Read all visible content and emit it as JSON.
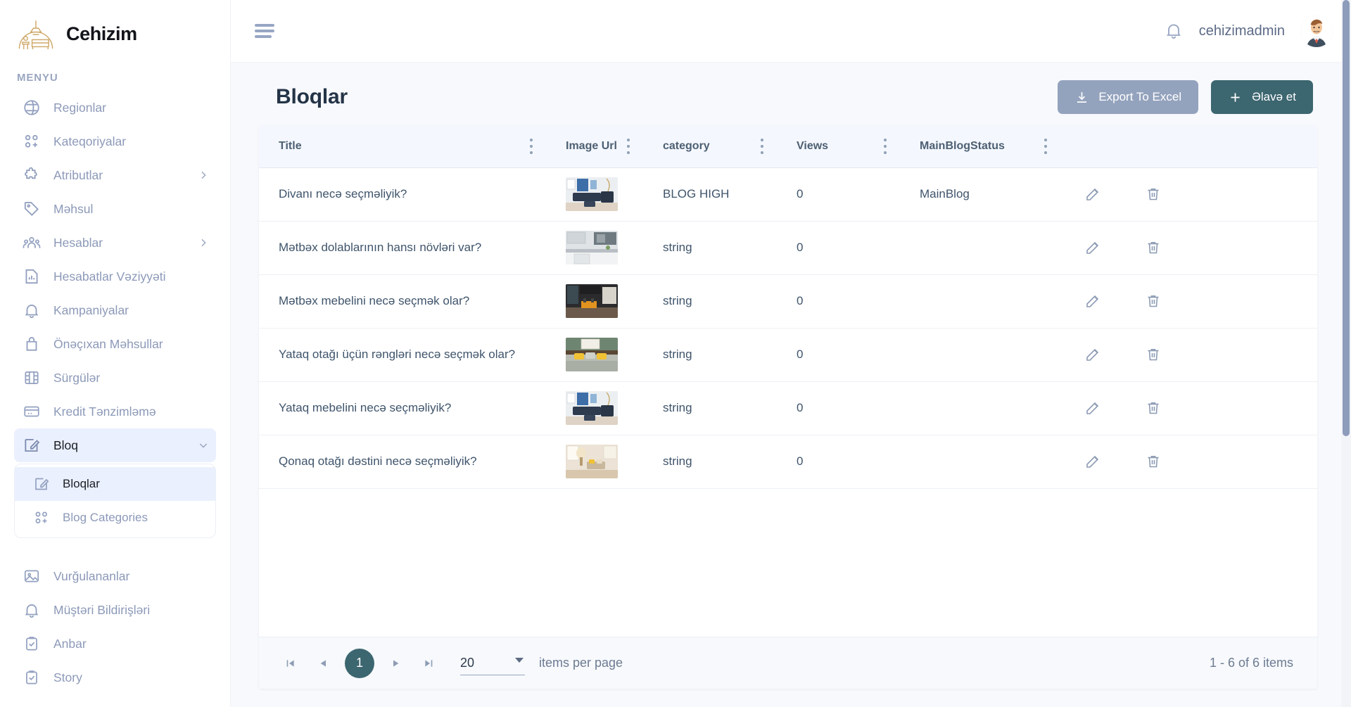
{
  "brand": {
    "name": "Cehizim",
    "logo_icon": "furniture-arch-logo"
  },
  "sidebar": {
    "section_label": "MENYU",
    "items": [
      {
        "label": "Regionlar",
        "icon": "globe-icon",
        "expandable": false
      },
      {
        "label": "Kateqoriyalar",
        "icon": "categories-icon",
        "expandable": false
      },
      {
        "label": "Atributlar",
        "icon": "puzzle-icon",
        "expandable": true
      },
      {
        "label": "Məhsul",
        "icon": "tag-icon",
        "expandable": false
      },
      {
        "label": "Hesablar",
        "icon": "users-icon",
        "expandable": true
      },
      {
        "label": "Hesabatlar Vəziyyəti",
        "icon": "report-icon",
        "expandable": false
      },
      {
        "label": "Kampaniyalar",
        "icon": "bell-icon",
        "expandable": false
      },
      {
        "label": "Önəçıxan Məhsullar",
        "icon": "bag-icon",
        "expandable": false
      },
      {
        "label": "Sürgülər",
        "icon": "film-icon",
        "expandable": false
      },
      {
        "label": "Kredit Tənzimləmə",
        "icon": "credit-card-icon",
        "expandable": false
      },
      {
        "label": "Bloq",
        "icon": "edit-square-icon",
        "expandable": true,
        "expanded": true,
        "active": true
      }
    ],
    "blog_submenu": [
      {
        "label": "Bloqlar",
        "icon": "edit-square-icon",
        "active": true
      },
      {
        "label": "Blog Categories",
        "icon": "categories-icon",
        "active": false
      }
    ],
    "bottom_items": [
      {
        "label": "Vurğulananlar",
        "icon": "image-icon"
      },
      {
        "label": "Müştəri Bildirişləri",
        "icon": "bell-icon"
      },
      {
        "label": "Anbar",
        "icon": "clipboard-check-icon"
      },
      {
        "label": "Story",
        "icon": "clipboard-check-icon"
      }
    ]
  },
  "topbar": {
    "menu_icon": "hamburger-icon",
    "notification_icon": "bell-icon",
    "username": "cehizimadmin",
    "avatar_icon": "user-avatar"
  },
  "page": {
    "title": "Bloqlar",
    "export_button": "Export To Excel",
    "export_icon": "download-icon",
    "add_button": "Əlavə et",
    "add_icon": "plus-icon"
  },
  "table": {
    "columns": [
      {
        "label": "Title",
        "key": "title"
      },
      {
        "label": "Image Url",
        "key": "image"
      },
      {
        "label": "category",
        "key": "category"
      },
      {
        "label": "Views",
        "key": "views"
      },
      {
        "label": "MainBlogStatus",
        "key": "status"
      }
    ],
    "kebab_icon": "more-vertical-icon",
    "edit_icon": "pencil-icon",
    "delete_icon": "trash-icon",
    "rows": [
      {
        "title": "Divanı necə seçməliyik?",
        "image": "living-room-sofa-thumbnail",
        "category": "BLOG HIGH",
        "views": "0",
        "status": "MainBlog"
      },
      {
        "title": "Mətbəx dolablarının hansı növləri var?",
        "image": "kitchen-cabinets-thumbnail",
        "category": "string",
        "views": "0",
        "status": ""
      },
      {
        "title": "Mətbəx mebelini necə seçmək olar?",
        "image": "dark-kitchen-thumbnail",
        "category": "string",
        "views": "0",
        "status": ""
      },
      {
        "title": "Yataq otağı üçün rəngləri necə seçmək olar?",
        "image": "bedroom-green-thumbnail",
        "category": "string",
        "views": "0",
        "status": ""
      },
      {
        "title": "Yataq mebelini necə seçməliyik?",
        "image": "living-room-sofa-thumbnail",
        "category": "string",
        "views": "0",
        "status": ""
      },
      {
        "title": "Qonaq otağı dəstini necə seçməliyik?",
        "image": "guest-room-thumbnail",
        "category": "string",
        "views": "0",
        "status": ""
      }
    ]
  },
  "pagination": {
    "first_icon": "first-page-icon",
    "prev_icon": "prev-page-icon",
    "current_page": "1",
    "next_icon": "next-page-icon",
    "last_icon": "last-page-icon",
    "page_size": "20",
    "page_size_label": "items per page",
    "range_text": "1 - 6 of 6 items"
  },
  "colors": {
    "accent_teal": "#3c6670",
    "export_grey": "#94a3bd",
    "sidebar_text": "#8c99b8",
    "active_bg": "#eaf0fd",
    "header_bg": "#f4f7fd",
    "page_bg": "#f7f9fc"
  }
}
